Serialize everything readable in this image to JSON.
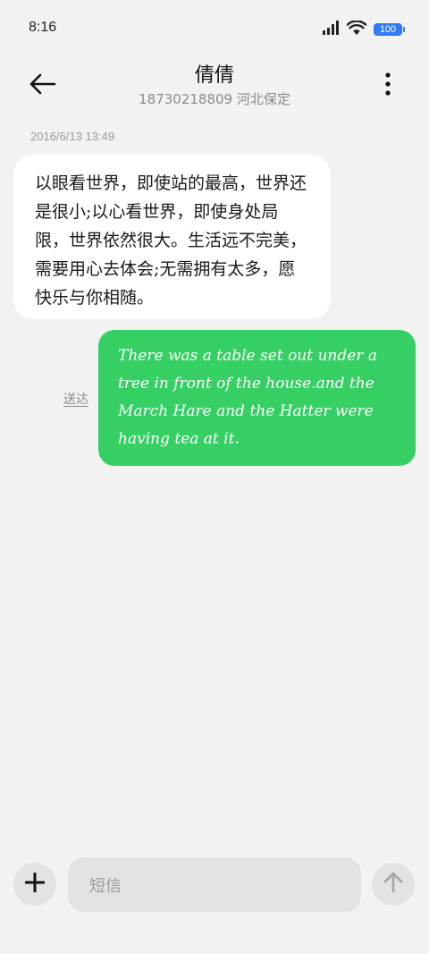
{
  "status_bar": {
    "time": "8:16",
    "battery_level": "100",
    "icons": [
      "signal-icon",
      "wifi-icon",
      "battery-icon"
    ]
  },
  "header": {
    "contact_name": "倩倩",
    "contact_subtitle": "18730218809 河北保定",
    "icons": [
      "back-arrow-icon",
      "more-vertical-icon"
    ]
  },
  "conversation": {
    "timestamp": "2016/6/13 13:49",
    "incoming_text": "以眼看世界，即使站的最高，世界还是很小;以心看世界，即使身处局限，世界依然很大。生活远不完美，需要用心去体会;无需拥有太多，愿快乐与你相随。",
    "outgoing_text": "There was a table set out under a tree in front of the house.and the March Hare and the Hatter were having tea at it.",
    "outgoing_status": "送达"
  },
  "composer": {
    "placeholder": "短信",
    "icons": [
      "plus-icon",
      "send-arrow-icon"
    ]
  },
  "colors": {
    "background": "#f2f2f2",
    "incoming_bubble": "#ffffff",
    "outgoing_bubble": "#35cf64",
    "battery": "#2f7cf6"
  }
}
